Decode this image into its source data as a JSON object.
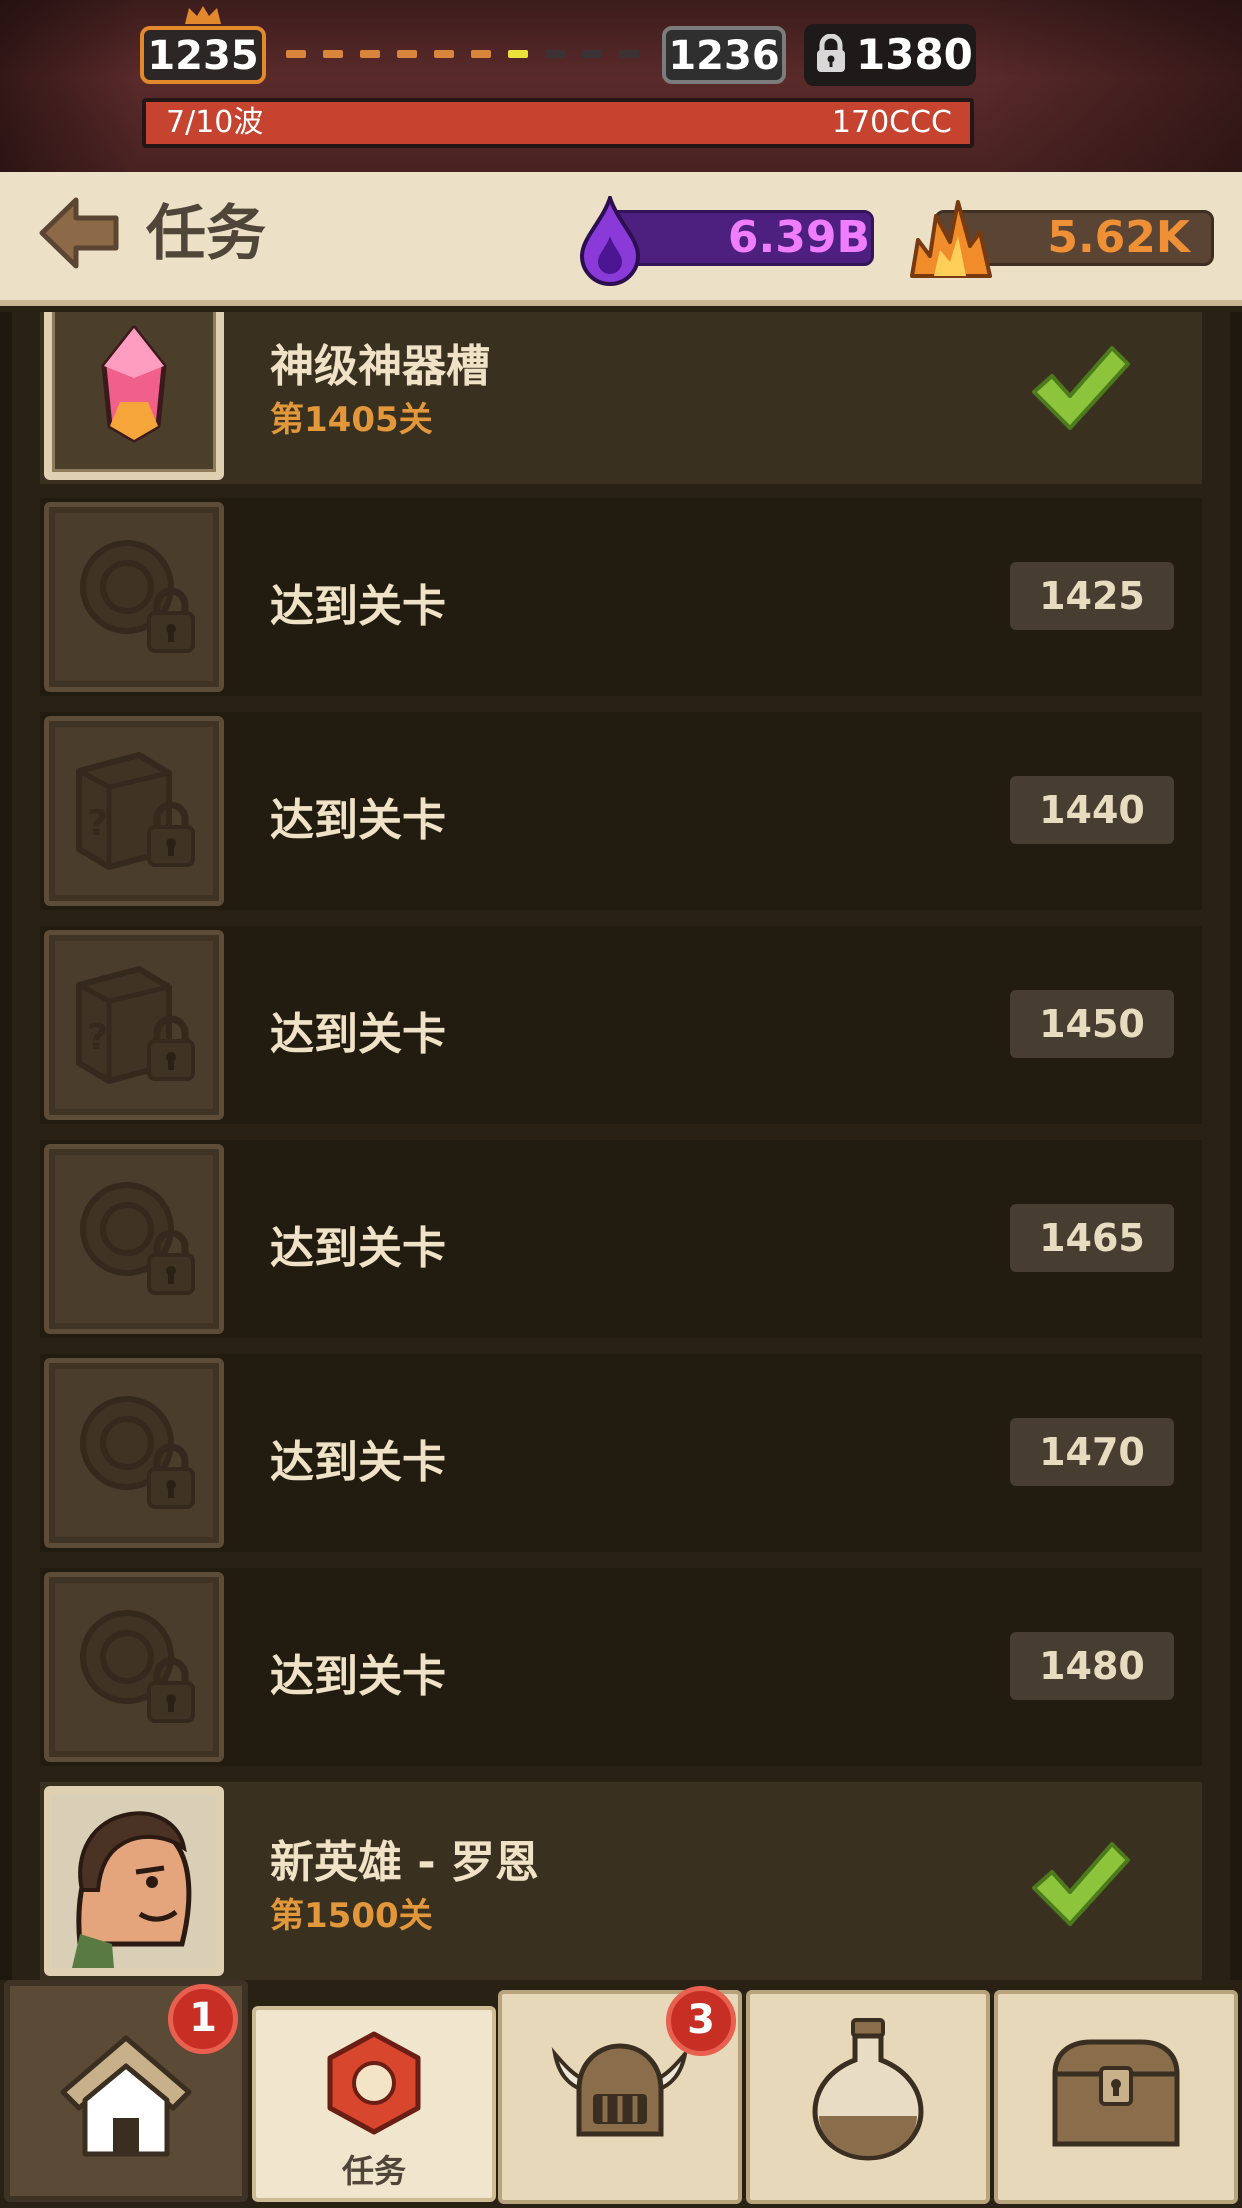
{
  "hud": {
    "current_level": "1235",
    "next_level": "1236",
    "locked_level": "1380",
    "wave_label": "7/10波",
    "enemy_hp": "170CCC"
  },
  "header": {
    "title": "任务",
    "back_icon": "back-arrow-icon",
    "purple_resource": {
      "icon": "purple-drop-icon",
      "value": "6.39B",
      "color": "#ef7dfc"
    },
    "orange_resource": {
      "icon": "orange-crystal-icon",
      "value": "5.62K",
      "color": "#f09036"
    }
  },
  "tasks": [
    {
      "title": "神级神器槽",
      "subtitle": "第1405关",
      "icon": "gem-icon",
      "status": "completed"
    },
    {
      "title": "达到关卡",
      "level": "1425",
      "icon": "locked-medal-icon",
      "status": "locked"
    },
    {
      "title": "达到关卡",
      "level": "1440",
      "icon": "locked-mystery-box-icon",
      "status": "locked"
    },
    {
      "title": "达到关卡",
      "level": "1450",
      "icon": "locked-mystery-box-icon",
      "status": "locked"
    },
    {
      "title": "达到关卡",
      "level": "1465",
      "icon": "locked-medal-icon",
      "status": "locked"
    },
    {
      "title": "达到关卡",
      "level": "1470",
      "icon": "locked-medal-icon",
      "status": "locked"
    },
    {
      "title": "达到关卡",
      "level": "1480",
      "icon": "locked-medal-icon",
      "status": "locked"
    },
    {
      "title": "新英雄 - 罗恩",
      "subtitle": "第1500关",
      "icon": "hero-portrait-icon",
      "status": "completed"
    }
  ],
  "nav": {
    "home": {
      "icon": "home-icon",
      "badge": "1"
    },
    "tasks": {
      "icon": "task-icon",
      "label": "任务"
    },
    "hero": {
      "icon": "helmet-icon",
      "badge": "3"
    },
    "potion": {
      "icon": "potion-icon"
    },
    "chest": {
      "icon": "chest-icon"
    }
  }
}
